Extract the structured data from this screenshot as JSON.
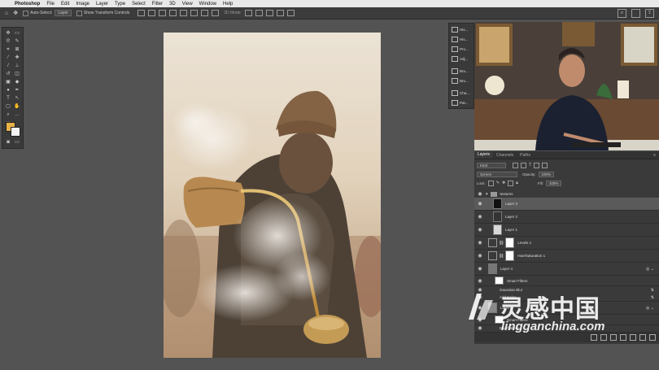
{
  "menubar": {
    "app": "Photoshop",
    "items": [
      "File",
      "Edit",
      "Image",
      "Layer",
      "Type",
      "Select",
      "Filter",
      "3D",
      "View",
      "Window",
      "Help"
    ]
  },
  "options": {
    "auto_select_label": "Auto-Select:",
    "auto_select_value": "Layer",
    "show_transform": "Show Transform Controls",
    "mode_label": "3D Mode:"
  },
  "panel_icons": [
    "His...",
    "His...",
    "Pro...",
    "Adj...",
    "Bru...",
    "Bru...",
    "Cha...",
    "Par..."
  ],
  "layers": {
    "tabs": [
      "Layers",
      "Channels",
      "Paths"
    ],
    "kind": "Kind",
    "blend": "Screen",
    "opacity_label": "Opacity:",
    "opacity_value": "100%",
    "lock_label": "Lock:",
    "fill_label": "Fill:",
    "fill_value": "100%",
    "items": [
      {
        "name": "textures"
      },
      {
        "name": "Layer 3"
      },
      {
        "name": "Layer 2"
      },
      {
        "name": "Layer 1"
      },
      {
        "name": "Levels 1"
      },
      {
        "name": "Hue/Saturation 1"
      },
      {
        "name": "Layer 4"
      },
      {
        "name": "Smart Filters"
      },
      {
        "name": "Gaussian Blur"
      },
      {
        "name": "Add Noise"
      },
      {
        "name": "Layer"
      },
      {
        "name": "Smart Filters"
      },
      {
        "name": "Blur Gallery"
      }
    ]
  },
  "watermark": {
    "main": "灵感中国",
    "sub": "lingganchina.com"
  }
}
